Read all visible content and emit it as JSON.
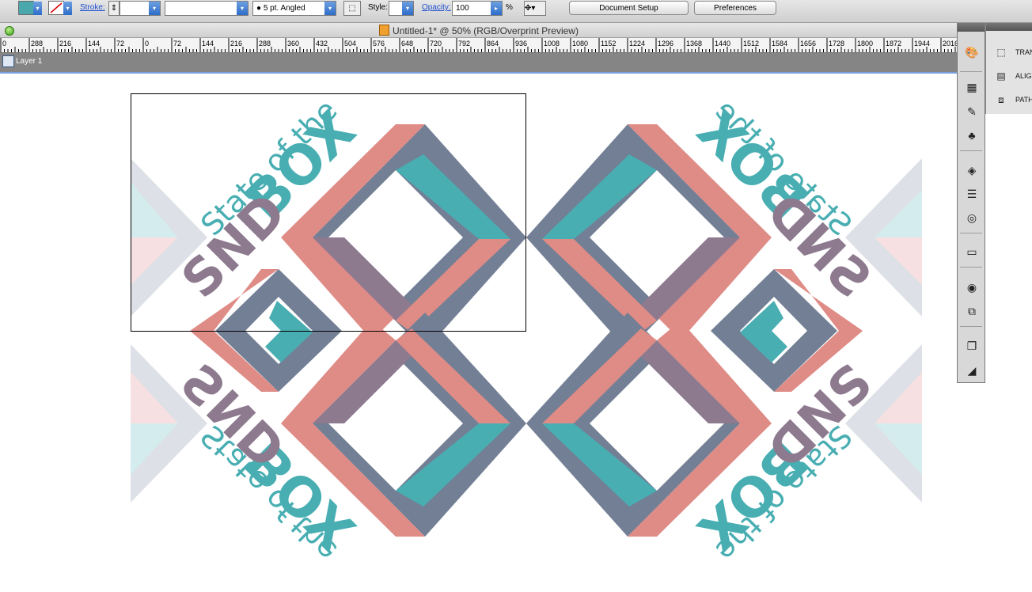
{
  "control_bar": {
    "stroke_label": "Stroke:",
    "stroke_style": "5 pt. Angled",
    "style_label": "Style:",
    "opacity_label": "Opacity:",
    "opacity_value": "100",
    "opacity_unit": "%",
    "document_setup": "Document Setup",
    "preferences": "Preferences",
    "fill_color": "#4aa7ab"
  },
  "window": {
    "title": "Untitled-1* @ 50% (RGB/Overprint Preview)"
  },
  "ruler": {
    "labels": [
      "0",
      "288",
      "216",
      "144",
      "72",
      "0",
      "72",
      "144",
      "216",
      "288",
      "360",
      "432",
      "504",
      "576",
      "648",
      "720",
      "792",
      "864",
      "936",
      "1008",
      "1080",
      "1152",
      "1224",
      "1296",
      "1368",
      "1440",
      "1512",
      "1584",
      "1656",
      "1728",
      "1800",
      "1872",
      "1944",
      "2016"
    ]
  },
  "layers": {
    "name": "Layer 1"
  },
  "artwork": {
    "text_line1": "State of the",
    "text_box": "BOX",
    "text_snd": "SND",
    "colors": {
      "teal": "#48aeb2",
      "coral": "#df8b86",
      "slate": "#737f95",
      "mauve": "#8d7a8e",
      "ghost": "#dde0e6",
      "ghost_teal": "#d4eced",
      "ghost_pink": "#f6e0e1"
    }
  },
  "panels": {
    "transform": "TRAN",
    "align": "ALIG",
    "pathfinder": "PATH"
  }
}
